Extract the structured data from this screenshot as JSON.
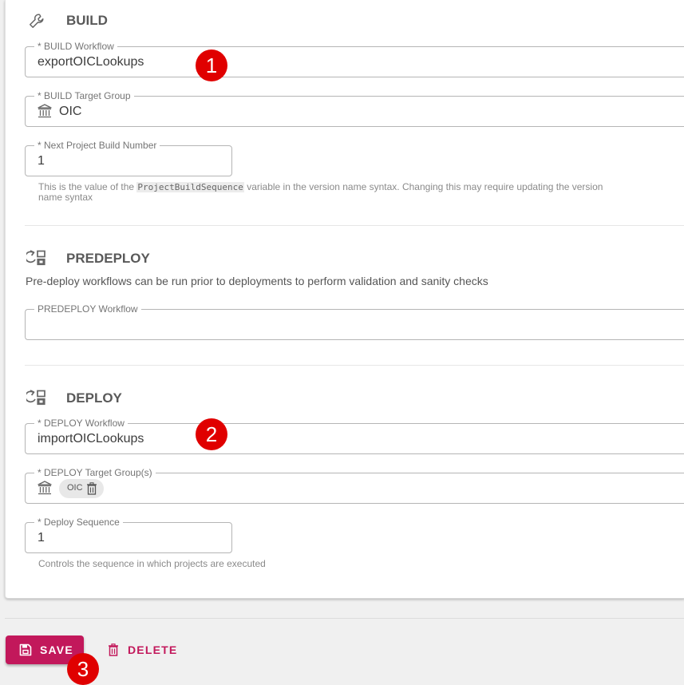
{
  "build": {
    "title": "BUILD",
    "workflow": {
      "label": "* BUILD Workflow",
      "value": "exportOICLookups"
    },
    "target_group": {
      "label": "* BUILD Target Group",
      "value": "OIC"
    },
    "next_build_number": {
      "label": "* Next Project Build Number",
      "value": "1",
      "helper_before": "This is the value of the ",
      "helper_code": "ProjectBuildSequence",
      "helper_after": " variable in the version name syntax. Changing this may require updating the version",
      "helper_line2": "name syntax"
    }
  },
  "predeploy": {
    "title": "PREDEPLOY",
    "description": "Pre-deploy workflows can be run prior to deployments to perform validation and sanity checks",
    "workflow": {
      "label": "PREDEPLOY Workflow",
      "value": ""
    }
  },
  "deploy": {
    "title": "DEPLOY",
    "workflow": {
      "label": "* DEPLOY Workflow",
      "value": "importOICLookups"
    },
    "target_groups": {
      "label": "* DEPLOY Target Group(s)",
      "chip": "OIC"
    },
    "sequence": {
      "label": "* Deploy Sequence",
      "value": "1",
      "helper": "Controls the sequence in which projects are executed"
    }
  },
  "annotations": [
    "1",
    "2",
    "3"
  ],
  "actions": {
    "save_label": "SAVE",
    "delete_label": "DELETE"
  },
  "colors": {
    "accent": "#c2185b",
    "badge": "#e00000"
  },
  "icons": [
    "cursor-icon",
    "wrench-icon",
    "bank-icon",
    "workflow-icon",
    "trash-icon",
    "floppy-disk-icon"
  ]
}
